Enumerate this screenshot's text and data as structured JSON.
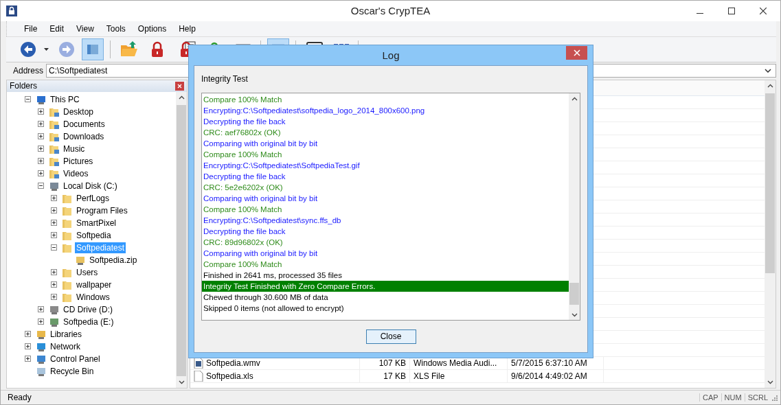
{
  "window": {
    "title": "Oscar's CrypTEA"
  },
  "menu": [
    "File",
    "Edit",
    "View",
    "Tools",
    "Options",
    "Help"
  ],
  "toolbar": [
    {
      "kind": "back",
      "selected": false
    },
    {
      "kind": "caret",
      "selected": false
    },
    {
      "kind": "forward",
      "selected": false
    },
    {
      "kind": "folders",
      "selected": true
    },
    {
      "kind": "open",
      "selected": false
    },
    {
      "kind": "lock",
      "selected": false
    },
    {
      "kind": "lock-list",
      "selected": false
    },
    {
      "kind": "unlock",
      "selected": false
    },
    {
      "kind": "list",
      "selected": false
    },
    {
      "kind": "blank",
      "selected": true
    },
    {
      "kind": "monitor",
      "selected": false
    },
    {
      "kind": "grid",
      "selected": false
    }
  ],
  "address": {
    "label": "Address",
    "value": "C:\\Softpediatest"
  },
  "folders": {
    "title": "Folders",
    "tree": [
      {
        "label": "This PC",
        "kind": "pc",
        "expandable": true,
        "expanded": true,
        "selected": false,
        "children": [
          {
            "label": "Desktop",
            "kind": "folder-desktop",
            "expandable": true,
            "expanded": false,
            "selected": false
          },
          {
            "label": "Documents",
            "kind": "folder-docs",
            "expandable": true,
            "expanded": false,
            "selected": false
          },
          {
            "label": "Downloads",
            "kind": "folder-down",
            "expandable": true,
            "expanded": false,
            "selected": false
          },
          {
            "label": "Music",
            "kind": "folder-music",
            "expandable": true,
            "expanded": false,
            "selected": false
          },
          {
            "label": "Pictures",
            "kind": "folder-pics",
            "expandable": true,
            "expanded": false,
            "selected": false
          },
          {
            "label": "Videos",
            "kind": "folder-video",
            "expandable": true,
            "expanded": false,
            "selected": false
          },
          {
            "label": "Local Disk (C:)",
            "kind": "disk",
            "expandable": true,
            "expanded": true,
            "selected": false,
            "children": [
              {
                "label": "PerfLogs",
                "kind": "folder",
                "expandable": true,
                "expanded": false,
                "selected": false
              },
              {
                "label": "Program Files",
                "kind": "folder",
                "expandable": true,
                "expanded": false,
                "selected": false
              },
              {
                "label": "SmartPixel",
                "kind": "folder",
                "expandable": true,
                "expanded": false,
                "selected": false
              },
              {
                "label": "Softpedia",
                "kind": "folder",
                "expandable": true,
                "expanded": false,
                "selected": false
              },
              {
                "label": "Softpediatest",
                "kind": "folder",
                "expandable": true,
                "expanded": true,
                "selected": true,
                "children": [
                  {
                    "label": "Softpedia.zip",
                    "kind": "zip",
                    "expandable": false,
                    "selected": false
                  }
                ]
              },
              {
                "label": "Users",
                "kind": "folder",
                "expandable": true,
                "expanded": false,
                "selected": false
              },
              {
                "label": "wallpaper",
                "kind": "folder",
                "expandable": true,
                "expanded": false,
                "selected": false
              },
              {
                "label": "Windows",
                "kind": "folder",
                "expandable": true,
                "expanded": false,
                "selected": false
              }
            ]
          },
          {
            "label": "CD Drive (D:)",
            "kind": "cd",
            "expandable": true,
            "expanded": false,
            "selected": false
          },
          {
            "label": "Softpedia (E:)",
            "kind": "net-drive",
            "expandable": true,
            "expanded": false,
            "selected": false
          }
        ]
      },
      {
        "label": "Libraries",
        "kind": "libraries",
        "expandable": true,
        "expanded": false,
        "selected": false
      },
      {
        "label": "Network",
        "kind": "network",
        "expandable": true,
        "expanded": false,
        "selected": false
      },
      {
        "label": "Control Panel",
        "kind": "control",
        "expandable": true,
        "expanded": false,
        "selected": false
      },
      {
        "label": "Recycle Bin",
        "kind": "recycle",
        "expandable": false,
        "selected": false
      }
    ]
  },
  "file_list": {
    "rows": [
      {
        "kind": "video",
        "cells": [
          "Softpedia.wmv",
          "107 KB",
          "Windows Media Audi...",
          "5/7/2015 6:37:10 AM"
        ]
      },
      {
        "kind": "file",
        "cells": [
          "Softpedia.xls",
          "17 KB",
          "XLS File",
          "9/6/2014 4:49:02 AM"
        ]
      }
    ]
  },
  "dialog": {
    "title": "Log",
    "heading": "Integrity Test",
    "button": "Close",
    "lines": [
      {
        "kind": "success",
        "text": "Compare 100% Match"
      },
      {
        "kind": "info",
        "text": "Encrypting:C:\\Softpediatest\\softpedia_logo_2014_800x600.png"
      },
      {
        "kind": "info",
        "text": "Decrypting the file back"
      },
      {
        "kind": "success",
        "text": "CRC: aef76802x (OK)"
      },
      {
        "kind": "info",
        "text": "Comparing with original bit by bit"
      },
      {
        "kind": "success",
        "text": "Compare 100% Match"
      },
      {
        "kind": "info",
        "text": "Encrypting:C:\\Softpediatest\\SoftpediaTest.gif"
      },
      {
        "kind": "info",
        "text": "Decrypting the file back"
      },
      {
        "kind": "success",
        "text": "CRC: 5e2e6202x (OK)"
      },
      {
        "kind": "info",
        "text": "Comparing with original bit by bit"
      },
      {
        "kind": "success",
        "text": "Compare 100% Match"
      },
      {
        "kind": "info",
        "text": "Encrypting:C:\\Softpediatest\\sync.ffs_db"
      },
      {
        "kind": "info",
        "text": "Decrypting the file back"
      },
      {
        "kind": "success",
        "text": "CRC: 89d96802x (OK)"
      },
      {
        "kind": "info",
        "text": "Comparing with original bit by bit"
      },
      {
        "kind": "success",
        "text": "Compare 100% Match"
      },
      {
        "kind": "plain",
        "text": "Finished in 2641 ms, processed 35 files"
      },
      {
        "kind": "highlight",
        "text": "Integrity Test Finished with Zero Compare Errors."
      },
      {
        "kind": "plain",
        "text": "Chewed through 30.600 MB of data"
      },
      {
        "kind": "plain",
        "text": "Skipped 0 items (not allowed to encrypt)"
      }
    ]
  },
  "status_bar": {
    "text": "Ready",
    "indicators": [
      "CAP",
      "NUM",
      "SCRL"
    ]
  }
}
